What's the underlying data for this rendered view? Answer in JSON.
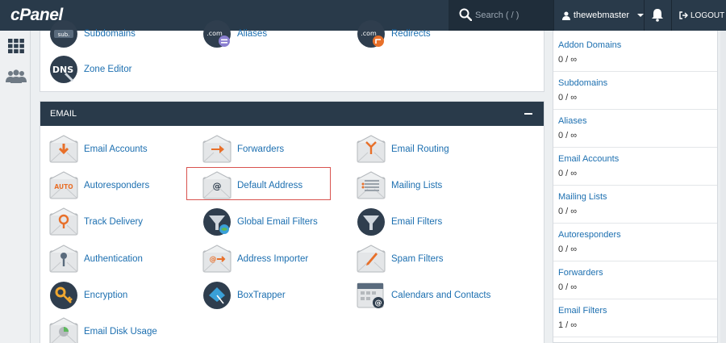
{
  "brand": {
    "logo": "cPanel"
  },
  "header": {
    "search_placeholder": "Search ( / )",
    "username": "thewebmaster",
    "logout_label": "LOGOUT"
  },
  "domains_section": {
    "items": [
      {
        "label": "Subdomains",
        "icon": "subdomains-icon"
      },
      {
        "label": "Aliases",
        "icon": "aliases-icon"
      },
      {
        "label": "Redirects",
        "icon": "redirects-icon"
      },
      {
        "label": "Zone Editor",
        "icon": "zone-editor-icon"
      }
    ]
  },
  "email_section": {
    "title": "EMAIL",
    "items": [
      {
        "label": "Email Accounts",
        "icon": "email-accounts-icon"
      },
      {
        "label": "Forwarders",
        "icon": "forwarders-icon"
      },
      {
        "label": "Email Routing",
        "icon": "email-routing-icon"
      },
      {
        "label": "Autoresponders",
        "icon": "autoresponders-icon"
      },
      {
        "label": "Default Address",
        "icon": "default-address-icon"
      },
      {
        "label": "Mailing Lists",
        "icon": "mailing-lists-icon"
      },
      {
        "label": "Track Delivery",
        "icon": "track-delivery-icon"
      },
      {
        "label": "Global Email Filters",
        "icon": "global-email-filters-icon"
      },
      {
        "label": "Email Filters",
        "icon": "email-filters-icon"
      },
      {
        "label": "Authentication",
        "icon": "authentication-icon"
      },
      {
        "label": "Address Importer",
        "icon": "address-importer-icon"
      },
      {
        "label": "Spam Filters",
        "icon": "spam-filters-icon"
      },
      {
        "label": "Encryption",
        "icon": "encryption-icon"
      },
      {
        "label": "BoxTrapper",
        "icon": "boxtrapper-icon"
      },
      {
        "label": "Calendars and Contacts",
        "icon": "calendars-contacts-icon"
      },
      {
        "label": "Email Disk Usage",
        "icon": "email-disk-usage-icon"
      }
    ]
  },
  "stats": [
    {
      "label": "Addon Domains",
      "value": "0 / ∞"
    },
    {
      "label": "Subdomains",
      "value": "0 / ∞"
    },
    {
      "label": "Aliases",
      "value": "0 / ∞"
    },
    {
      "label": "Email Accounts",
      "value": "0 / ∞"
    },
    {
      "label": "Mailing Lists",
      "value": "0 / ∞"
    },
    {
      "label": "Autoresponders",
      "value": "0 / ∞"
    },
    {
      "label": "Forwarders",
      "value": "0 / ∞"
    },
    {
      "label": "Email Filters",
      "value": "1 / ∞"
    }
  ],
  "colors": {
    "header_bg": "#293a4a",
    "link": "#1c6fb0",
    "accent_orange": "#e8702a",
    "highlight": "#d9534f"
  }
}
